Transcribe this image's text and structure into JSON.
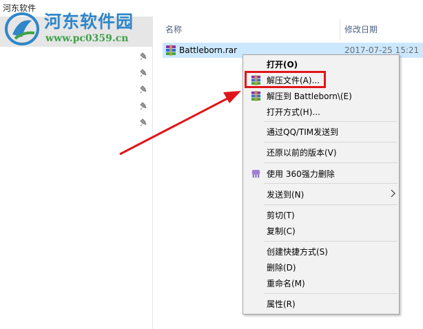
{
  "window": {
    "title": "河东软件"
  },
  "watermark": {
    "title": "河东软件园",
    "url": "www.pc0359.cn"
  },
  "columns": {
    "name": "名称",
    "modified": "修改日期"
  },
  "file": {
    "name": "Battleborn.rar",
    "date": "2017-07-25 15:21"
  },
  "quick_access_pins": [
    "pin-icon",
    "pin-icon",
    "pin-icon",
    "pin-icon",
    "pin-icon"
  ],
  "context_menu": {
    "open": "打开(O)",
    "extract_files": "解压文件(A)...",
    "extract_to": "解压到 Battleborn\\(E)",
    "open_with": "打开方式(H)...",
    "send_qq": "通过QQ/TIM发送到",
    "restore_previous": "还原以前的版本(V)",
    "force_delete": "使用 360强力删除",
    "send_to": "发送到(N)",
    "cut": "剪切(T)",
    "copy": "复制(C)",
    "create_shortcut": "创建快捷方式(S)",
    "delete": "删除(D)",
    "rename": "重命名(M)",
    "properties": "属性(R)"
  },
  "colors": {
    "selection": "#cce8ff",
    "highlight_box": "#e0151a",
    "watermark_blue": "#2f86c9",
    "watermark_green": "#3fa14a"
  }
}
